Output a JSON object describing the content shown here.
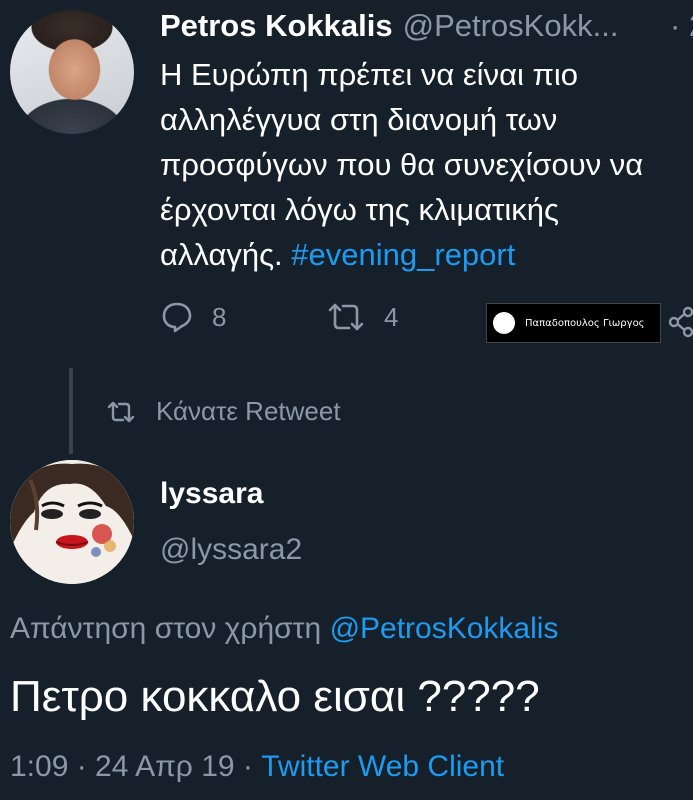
{
  "tweet1": {
    "display_name": "Petros Kokkalis",
    "handle": "@PetrosKokk...",
    "time_dot": "· 2",
    "text_lines": [
      "Η Ευρώπη πρέπει να είναι πιο",
      "αλληλέγγυα στη διανομή των",
      "προσφύγων που θα συνεχίσουν να",
      "έρχονται λόγω της κλιματικής"
    ],
    "text_last_line": "αλλαγής.",
    "hashtag": "#evening_report",
    "reply_count": "8",
    "retweet_count": "4",
    "watermark_text": "Παπαδοπουλος Γιωργος"
  },
  "retweet_notice": "Κάνατε Retweet",
  "tweet2": {
    "display_name": "lyssara",
    "handle": "@lyssara2",
    "reply_prefix": "Απάντηση στον χρήστη",
    "reply_mention": "@PetrosKokkalis",
    "text": "Πετρο κοκκαλο εισαι ?????",
    "time": "1:09 · 24 Απρ 19 · ",
    "client": "Twitter Web Client"
  },
  "icons": {
    "reply": "reply-bubble-icon",
    "retweet": "retweet-arrows-icon",
    "share": "share-icon"
  },
  "colors": {
    "background": "#16202b",
    "accent": "#1d9bf0",
    "muted": "#8b98a5"
  }
}
